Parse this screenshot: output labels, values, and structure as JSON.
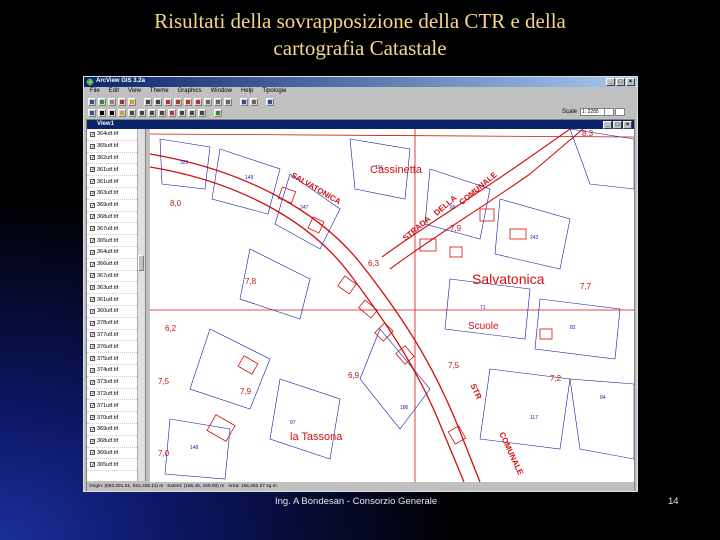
{
  "slide": {
    "title_line1": "Risultati della sovrapposizione della CTR e della",
    "title_line2": "cartografia Catastale",
    "credit": "Ing. A Bondesan - Consorzio Generale",
    "page_number": "14"
  },
  "window": {
    "title": "ArcView GIS 3.2a",
    "menus": [
      "File",
      "Edit",
      "View",
      "Theme",
      "Graphics",
      "Window",
      "Help",
      "Tipologie"
    ],
    "scale_label": "Scale",
    "scale_value": "1: 2285",
    "view_title": "View1"
  },
  "toc": {
    "themes": [
      "364utf.tif",
      "365utf.tif",
      "362utf.tif",
      "361utf.tif",
      "361utf.tif",
      "363utf.tif",
      "369utf.tif",
      "368utf.tif",
      "367utf.tif",
      "365utf.tif",
      "364utf.tif",
      "366utf.tif",
      "367utf.tif",
      "363utf.tif",
      "361utf.tif",
      "360utf.tif",
      "378utf.tif",
      "377utf.tif",
      "376utf.tif",
      "375utf.tif",
      "374utf.tif",
      "373utf.tif",
      "372utf.tif",
      "371utf.tif",
      "370utf.tif",
      "369utf.tif",
      "368utf.tif",
      "366utf.tif",
      "365utf.tif"
    ]
  },
  "status_bar": {
    "origin": "Origin: (653,281.51, 922,408.11) m",
    "extent": "Extent: (165,45, 160.00) m",
    "area": "Area: 155,492.27 sq m"
  },
  "map": {
    "labels": {
      "cassinetta": "Cassinetta",
      "salvatonica": "Salvatonica",
      "salvatonica_road": "SALVATONICA",
      "scuole": "Scuole",
      "la_tassona": "la Tassona",
      "strada": "STRADA",
      "comunale": "COMUNALE",
      "della": "DELLA",
      "strada2": "STR",
      "comunale2": "COMUNALE",
      "h1": "8,0",
      "h2": "7,8",
      "h3": "6,3",
      "h4": "6,2",
      "h5": "7,5",
      "h6": "7,9",
      "h7": "6,9",
      "h8": "7,0",
      "h9": "7,5",
      "h10": "7,2",
      "h11": "7,7",
      "h12": "8,3",
      "h13": "7,9"
    },
    "colors": {
      "ctr": "#d01010",
      "cadastre": "#1a1aa0"
    }
  },
  "icons": {
    "window_icon": "arcview-globe-icon",
    "minimize": "minimize-icon",
    "maximize": "maximize-icon",
    "close": "close-icon"
  }
}
